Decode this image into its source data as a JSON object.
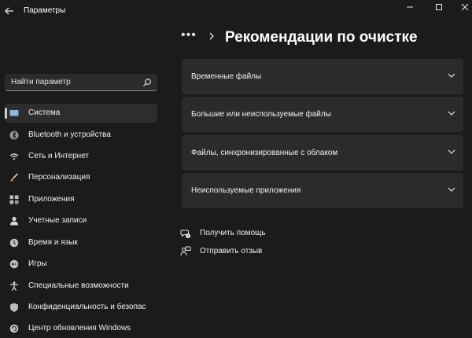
{
  "window": {
    "title": "Параметры"
  },
  "search": {
    "placeholder": "Найти параметр"
  },
  "sidebar": {
    "items": [
      {
        "label": "Система",
        "icon": "display-icon",
        "selected": true
      },
      {
        "label": "Bluetooth и устройства",
        "icon": "bluetooth-icon"
      },
      {
        "label": "Сеть и Интернет",
        "icon": "wifi-icon"
      },
      {
        "label": "Персонализация",
        "icon": "brush-icon"
      },
      {
        "label": "Приложения",
        "icon": "apps-icon"
      },
      {
        "label": "Учетные записи",
        "icon": "person-icon"
      },
      {
        "label": "Время и язык",
        "icon": "globe-clock-icon"
      },
      {
        "label": "Игры",
        "icon": "gamepad-icon"
      },
      {
        "label": "Специальные возможности",
        "icon": "accessibility-icon"
      },
      {
        "label": "Конфиденциальность и безопас",
        "icon": "shield-icon"
      },
      {
        "label": "Центр обновления Windows",
        "icon": "update-icon"
      }
    ]
  },
  "header": {
    "breadcrumb_more": "•••",
    "title": "Рекомендации по очистке"
  },
  "cards": [
    {
      "label": "Временные файлы"
    },
    {
      "label": "Большие или неиспользуемые файлы"
    },
    {
      "label": "Файлы, синхронизированные с облаком"
    },
    {
      "label": "Неиспользуемые приложения"
    }
  ],
  "links": {
    "help": "Получить помощь",
    "feedback": "Отправить отзыв"
  },
  "colors": {
    "background": "#1b1b1b",
    "card": "#2b2b2b",
    "selected_item": "#2d2d2d",
    "text": "#ffffff"
  }
}
